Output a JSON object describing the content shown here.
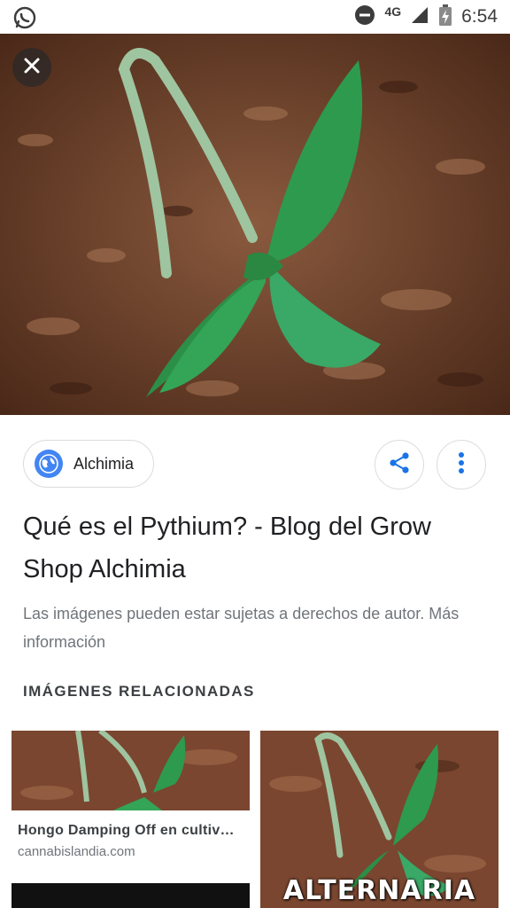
{
  "status_bar": {
    "network": "4G",
    "time": "6:54"
  },
  "viewer": {
    "source_name": "Alchimia",
    "title": "Qué es el Pythium? - Blog del Grow Shop Alchimia",
    "copyright_notice": "Las imágenes pueden estar sujetas a derechos de autor. Más información"
  },
  "related": {
    "heading": "IMÁGENES RELACIONADAS",
    "items": [
      {
        "caption": "Hongo Damping Off en cultiv…",
        "domain": "cannabislandia.com"
      },
      {
        "watermark": "ALTERNARIA"
      }
    ]
  },
  "colors": {
    "accent": "#4285f4",
    "leaf": "#2e9a4e",
    "soil": "#6b3e2a"
  },
  "icons": [
    "whatsapp-icon",
    "dnd-icon",
    "signal-icon",
    "battery-icon",
    "close-icon",
    "globe-icon",
    "share-icon",
    "more-vert-icon"
  ]
}
